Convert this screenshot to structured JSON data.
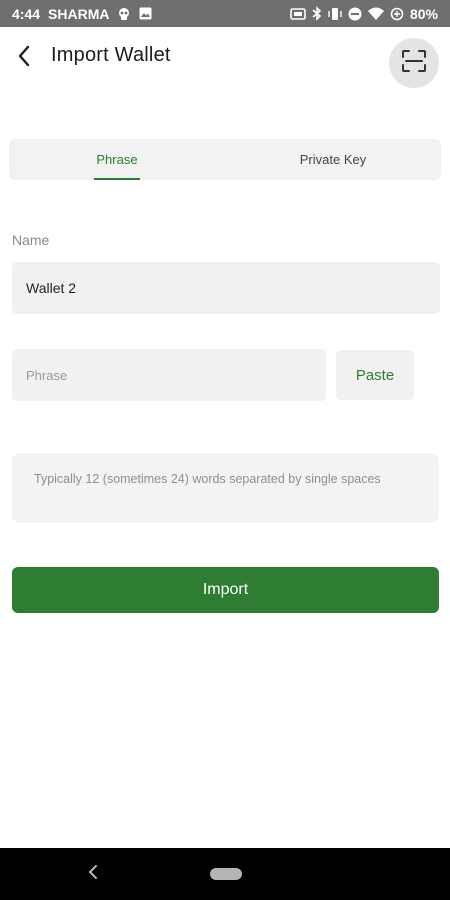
{
  "status_bar": {
    "time": "4:44",
    "carrier": "SHARMA",
    "battery": "80%",
    "icons": [
      "skull-icon",
      "image-icon",
      "nfc-icon",
      "bluetooth-icon",
      "vibrate-icon",
      "do-not-disturb-icon",
      "wifi-icon",
      "data-saver-icon"
    ]
  },
  "header": {
    "title": "Import Wallet",
    "back_icon": "chevron-left-icon",
    "scan_icon": "scan-frame-icon"
  },
  "tabs": [
    {
      "label": "Phrase",
      "active": true
    },
    {
      "label": "Private Key",
      "active": false
    }
  ],
  "form": {
    "name_label": "Name",
    "name_value": "Wallet 2",
    "phrase_placeholder": "Phrase",
    "phrase_value": "",
    "paste_label": "Paste",
    "hint": "Typically 12 (sometimes 24) words separated by single spaces",
    "import_label": "Import"
  },
  "colors": {
    "accent": "#2e7d32",
    "field_bg": "#f1f1f1",
    "status_bar": "#6f6f6f"
  }
}
